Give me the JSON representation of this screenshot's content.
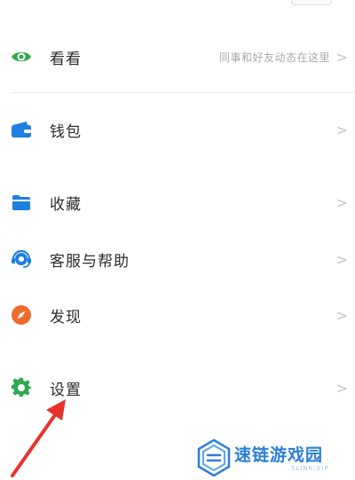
{
  "menu": {
    "items": [
      {
        "key": "kankan",
        "label": "看看",
        "hint": "同事和好友动态在这里",
        "icon": "eye-icon",
        "color": "#2fa84f"
      },
      {
        "key": "wallet",
        "label": "钱包",
        "hint": "",
        "icon": "wallet-icon",
        "color": "#1f7fe0"
      },
      {
        "key": "favorites",
        "label": "收藏",
        "hint": "",
        "icon": "folder-icon",
        "color": "#1f7fe0"
      },
      {
        "key": "support",
        "label": "客服与帮助",
        "hint": "",
        "icon": "headset-icon",
        "color": "#1f7fe0"
      },
      {
        "key": "discover",
        "label": "发现",
        "hint": "",
        "icon": "compass-icon",
        "color": "#ee6b2c"
      },
      {
        "key": "settings",
        "label": "设置",
        "hint": "",
        "icon": "gear-icon",
        "color": "#2fa84f"
      }
    ],
    "chevron": ">"
  },
  "watermark": {
    "title": "速链游戏园",
    "subtitle": "SLINK.VIP",
    "color": "#2a7fd6"
  },
  "annotation": {
    "arrow_color": "#e8322c"
  }
}
